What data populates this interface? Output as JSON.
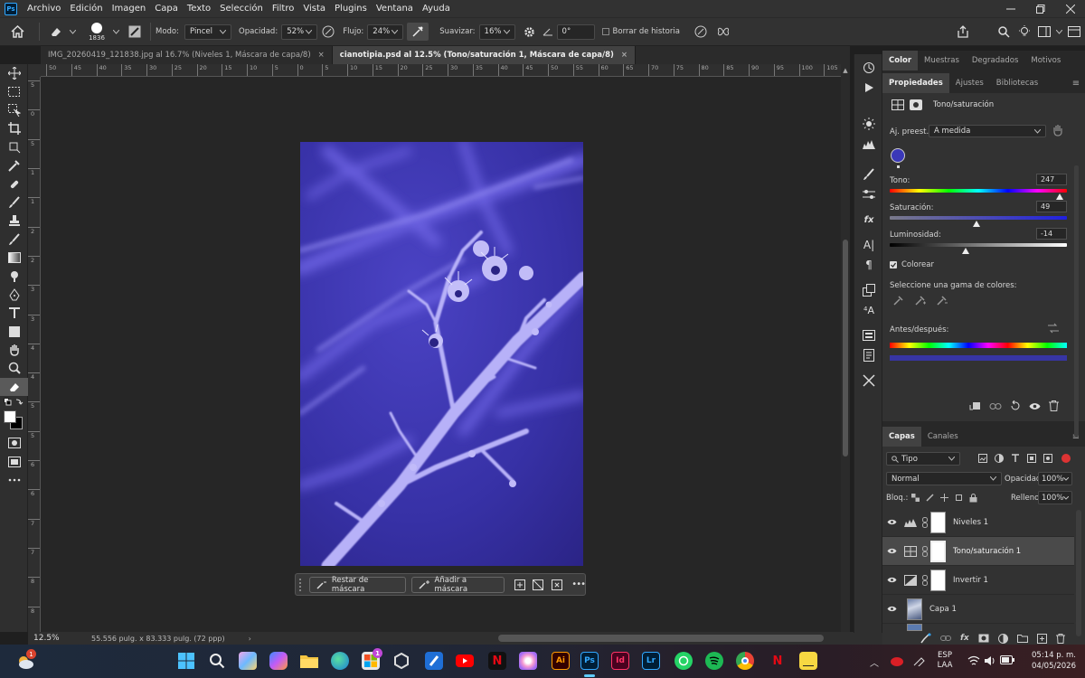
{
  "app": {
    "logo_text": "Ps",
    "menu": [
      "Archivo",
      "Edición",
      "Imagen",
      "Capa",
      "Texto",
      "Selección",
      "Filtro",
      "Vista",
      "Plugins",
      "Ventana",
      "Ayuda"
    ]
  },
  "options": {
    "brush_size": "1836",
    "mode_label": "Modo:",
    "mode_value": "Pincel",
    "opacity_label": "Opacidad:",
    "opacity_value": "52%",
    "flow_label": "Flujo:",
    "flow_value": "24%",
    "smooth_label": "Suavizar:",
    "smooth_value": "16%",
    "angle_value": "0°",
    "erase_history_label": "Borrar de historia"
  },
  "tabs": [
    {
      "label": "IMG_20260419_121838.jpg al 16.7% (Niveles 1, Máscara de capa/8)",
      "close": "×",
      "active": false
    },
    {
      "label": "cianotipia.psd al 12.5% (Tono/saturación 1, Máscara de capa/8)",
      "close": "×",
      "active": true
    }
  ],
  "rulers": {
    "h_ticks": [
      "50",
      "45",
      "40",
      "35",
      "30",
      "25",
      "20",
      "15",
      "10",
      "5",
      "0",
      "5",
      "10",
      "15",
      "20",
      "25",
      "30",
      "35",
      "40",
      "45",
      "50",
      "55",
      "60",
      "65",
      "70",
      "75",
      "80",
      "85",
      "90",
      "95",
      "100",
      "105"
    ],
    "v_ticks": [
      "5",
      "0",
      "5",
      "1",
      "1",
      "2",
      "2",
      "3",
      "3",
      "4",
      "4",
      "5",
      "5",
      "6",
      "6",
      "7",
      "7",
      "8",
      "8"
    ]
  },
  "context_bar": {
    "subtract_label": "Restar de máscara",
    "add_label": "Añadir a máscara",
    "more": "•••"
  },
  "status": {
    "zoom": "12.5%",
    "doc_size": "55.556 pulg. x 83.333 pulg. (72 ppp)"
  },
  "panel_top": {
    "tabs": [
      "Color",
      "Muestras",
      "Degradados",
      "Motivos"
    ]
  },
  "properties": {
    "tabs": [
      "Propiedades",
      "Ajustes",
      "Bibliotecas"
    ],
    "adjustment_name": "Tono/saturación",
    "preset_label": "Aj. preest.:",
    "preset_value": "A medida",
    "hue_label": "Tono:",
    "hue_value": "247",
    "hue": 247,
    "saturation_label": "Saturación:",
    "saturation_value": "49",
    "saturation": 49,
    "lightness_label": "Luminosidad:",
    "lightness_value": "-14",
    "lightness": -14,
    "colorize_label": "Colorear",
    "range_label": "Seleccione una gama de colores:",
    "before_after_label": "Antes/después:"
  },
  "layers_panel": {
    "tabs": [
      "Capas",
      "Canales"
    ],
    "filter_kind": "Tipo",
    "blend_mode": "Normal",
    "opacity_label": "Opacidad:",
    "opacity_value": "100%",
    "lock_label": "Bloq.:",
    "fill_label": "Relleno:",
    "fill_value": "100%",
    "layers": [
      {
        "name": "Niveles 1",
        "type": "levels",
        "selected": false
      },
      {
        "name": "Tono/saturación 1",
        "type": "hue-saturation",
        "selected": true
      },
      {
        "name": "Invertir 1",
        "type": "invert",
        "selected": false
      },
      {
        "name": "Capa 1",
        "type": "pixel",
        "selected": false
      }
    ]
  },
  "taskbar": {
    "notification_count": "1",
    "store_badge": "1",
    "language": "ESP",
    "language_sub": "LAA",
    "time": "05:14 p. m.",
    "date": "04/05/2026"
  },
  "colors": {
    "accent_purple": "#3a38b8",
    "ps_blue": "#31a8ff",
    "ui_dark": "#323232"
  }
}
